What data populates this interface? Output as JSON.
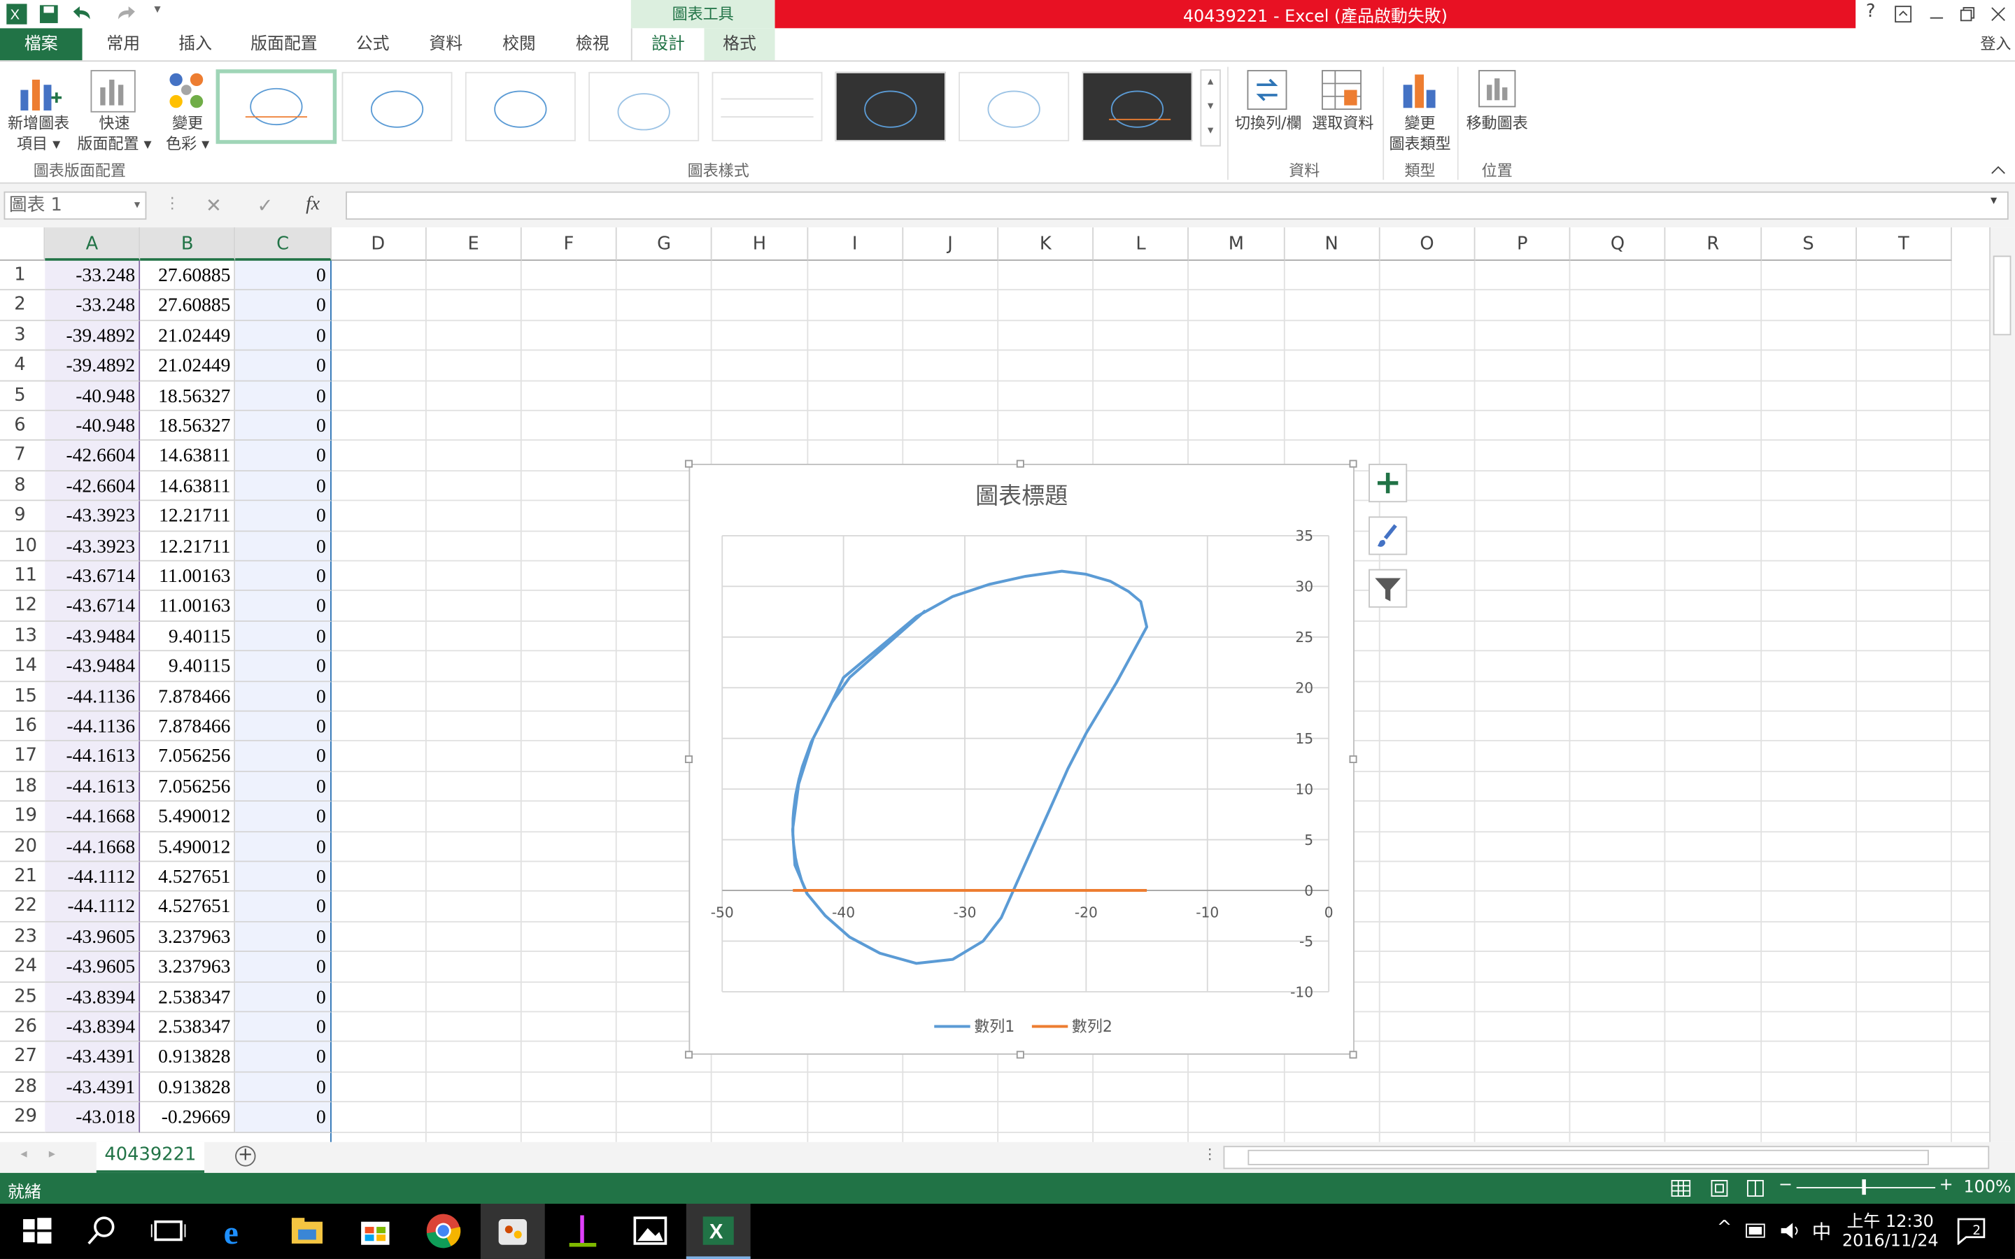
{
  "window": {
    "title": "40439221 -  Excel (產品啟動失敗)",
    "context_tab": "圖表工具",
    "login": "登入",
    "help": "?",
    "controls": [
      "restore-ribbon",
      "minimize",
      "restore",
      "close"
    ]
  },
  "tabs": [
    {
      "label": "檔案"
    },
    {
      "label": "常用"
    },
    {
      "label": "插入"
    },
    {
      "label": "版面配置"
    },
    {
      "label": "公式"
    },
    {
      "label": "資料"
    },
    {
      "label": "校閱"
    },
    {
      "label": "檢視"
    },
    {
      "label": "設計"
    },
    {
      "label": "格式"
    }
  ],
  "ribbon": {
    "add_element_1": "新增圖表",
    "add_element_2": "項目",
    "quick_layout_1": "快速",
    "quick_layout_2": "版面配置",
    "change_colors_1": "變更",
    "change_colors_2": "色彩",
    "group_layouts": "圖表版面配置",
    "group_styles": "圖表樣式",
    "switch_row_col": "切換列/欄",
    "select_data": "選取資料",
    "group_data": "資料",
    "change_type_1": "變更",
    "change_type_2": "圖表類型",
    "group_type": "類型",
    "move_chart": "移動圖表",
    "group_location": "位置"
  },
  "formula_bar": {
    "name_box": "圖表 1",
    "fx": "fx",
    "value": ""
  },
  "columns": [
    "A",
    "B",
    "C",
    "D",
    "E",
    "F",
    "G",
    "H",
    "I",
    "J",
    "K",
    "L",
    "M",
    "N",
    "O",
    "P",
    "Q",
    "R",
    "S",
    "T"
  ],
  "rows": [
    {
      "n": "1",
      "a": "-33.248",
      "b": "27.60885",
      "c": "0"
    },
    {
      "n": "2",
      "a": "-33.248",
      "b": "27.60885",
      "c": "0"
    },
    {
      "n": "3",
      "a": "-39.4892",
      "b": "21.02449",
      "c": "0"
    },
    {
      "n": "4",
      "a": "-39.4892",
      "b": "21.02449",
      "c": "0"
    },
    {
      "n": "5",
      "a": "-40.948",
      "b": "18.56327",
      "c": "0"
    },
    {
      "n": "6",
      "a": "-40.948",
      "b": "18.56327",
      "c": "0"
    },
    {
      "n": "7",
      "a": "-42.6604",
      "b": "14.63811",
      "c": "0"
    },
    {
      "n": "8",
      "a": "-42.6604",
      "b": "14.63811",
      "c": "0"
    },
    {
      "n": "9",
      "a": "-43.3923",
      "b": "12.21711",
      "c": "0"
    },
    {
      "n": "10",
      "a": "-43.3923",
      "b": "12.21711",
      "c": "0"
    },
    {
      "n": "11",
      "a": "-43.6714",
      "b": "11.00163",
      "c": "0"
    },
    {
      "n": "12",
      "a": "-43.6714",
      "b": "11.00163",
      "c": "0"
    },
    {
      "n": "13",
      "a": "-43.9484",
      "b": "9.40115",
      "c": "0"
    },
    {
      "n": "14",
      "a": "-43.9484",
      "b": "9.40115",
      "c": "0"
    },
    {
      "n": "15",
      "a": "-44.1136",
      "b": "7.878466",
      "c": "0"
    },
    {
      "n": "16",
      "a": "-44.1136",
      "b": "7.878466",
      "c": "0"
    },
    {
      "n": "17",
      "a": "-44.1613",
      "b": "7.056256",
      "c": "0"
    },
    {
      "n": "18",
      "a": "-44.1613",
      "b": "7.056256",
      "c": "0"
    },
    {
      "n": "19",
      "a": "-44.1668",
      "b": "5.490012",
      "c": "0"
    },
    {
      "n": "20",
      "a": "-44.1668",
      "b": "5.490012",
      "c": "0"
    },
    {
      "n": "21",
      "a": "-44.1112",
      "b": "4.527651",
      "c": "0"
    },
    {
      "n": "22",
      "a": "-44.1112",
      "b": "4.527651",
      "c": "0"
    },
    {
      "n": "23",
      "a": "-43.9605",
      "b": "3.237963",
      "c": "0"
    },
    {
      "n": "24",
      "a": "-43.9605",
      "b": "3.237963",
      "c": "0"
    },
    {
      "n": "25",
      "a": "-43.8394",
      "b": "2.538347",
      "c": "0"
    },
    {
      "n": "26",
      "a": "-43.8394",
      "b": "2.538347",
      "c": "0"
    },
    {
      "n": "27",
      "a": "-43.4391",
      "b": "0.913828",
      "c": "0"
    },
    {
      "n": "28",
      "a": "-43.4391",
      "b": "0.913828",
      "c": "0"
    },
    {
      "n": "29",
      "a": "-43.018",
      "b": "-0.29669",
      "c": "0"
    }
  ],
  "chart_data": {
    "type": "scatter",
    "title": "圖表標題",
    "xlim": [
      -50,
      0
    ],
    "ylim": [
      -10,
      35
    ],
    "x_ticks": [
      "-50",
      "-40",
      "-30",
      "-20",
      "-10",
      "0"
    ],
    "y_ticks": [
      "35",
      "30",
      "25",
      "20",
      "15",
      "10",
      "5",
      "0",
      "-5",
      "-10"
    ],
    "grid": true,
    "legend": "bottom",
    "series": [
      {
        "name": "數列1",
        "color": "#5b9bd5",
        "points": [
          [
            -33.25,
            27.61
          ],
          [
            -39.49,
            21.02
          ],
          [
            -40.95,
            18.56
          ],
          [
            -42.66,
            14.64
          ],
          [
            -43.39,
            12.22
          ],
          [
            -43.67,
            11.0
          ],
          [
            -43.95,
            9.4
          ],
          [
            -44.11,
            7.88
          ],
          [
            -44.16,
            7.06
          ],
          [
            -44.17,
            5.49
          ],
          [
            -44.11,
            4.53
          ],
          [
            -43.96,
            3.24
          ],
          [
            -43.84,
            2.54
          ],
          [
            -43.44,
            0.91
          ],
          [
            -43.02,
            -0.3
          ],
          [
            -41.5,
            -2.5
          ],
          [
            -39.5,
            -4.6
          ],
          [
            -37.0,
            -6.2
          ],
          [
            -34.0,
            -7.2
          ],
          [
            -31.0,
            -6.8
          ],
          [
            -28.5,
            -5.0
          ],
          [
            -27.0,
            -2.7
          ],
          [
            -26.0,
            0.0
          ],
          [
            -24.5,
            4.0
          ],
          [
            -23.0,
            8.0
          ],
          [
            -21.5,
            12.0
          ],
          [
            -20.0,
            15.5
          ],
          [
            -17.5,
            20.5
          ],
          [
            -15.0,
            26.0
          ],
          [
            -15.5,
            28.5
          ],
          [
            -16.5,
            29.5
          ],
          [
            -18.0,
            30.5
          ],
          [
            -20.0,
            31.2
          ],
          [
            -22.0,
            31.5
          ],
          [
            -25.0,
            31.0
          ],
          [
            -28.0,
            30.2
          ],
          [
            -31.0,
            29.0
          ],
          [
            -34.0,
            27.0
          ],
          [
            -37.0,
            24.0
          ],
          [
            -40.0,
            21.0
          ],
          [
            -41.0,
            18.5
          ],
          [
            -42.5,
            15.0
          ],
          [
            -43.7,
            10.5
          ],
          [
            -44.2,
            6.0
          ],
          [
            -44.0,
            2.5
          ],
          [
            -43.0,
            -0.3
          ]
        ]
      },
      {
        "name": "數列2",
        "color": "#ed7d31",
        "points": [
          [
            -44.17,
            0
          ],
          [
            -15.0,
            0
          ]
        ]
      }
    ]
  },
  "sheet": {
    "tab": "40439221",
    "add": "+"
  },
  "status": {
    "ready": "就緒",
    "zoom": "100%"
  },
  "taskbar": {
    "time": "上午 12:30",
    "date": "2016/11/24",
    "ime": "中",
    "notif": "2"
  }
}
